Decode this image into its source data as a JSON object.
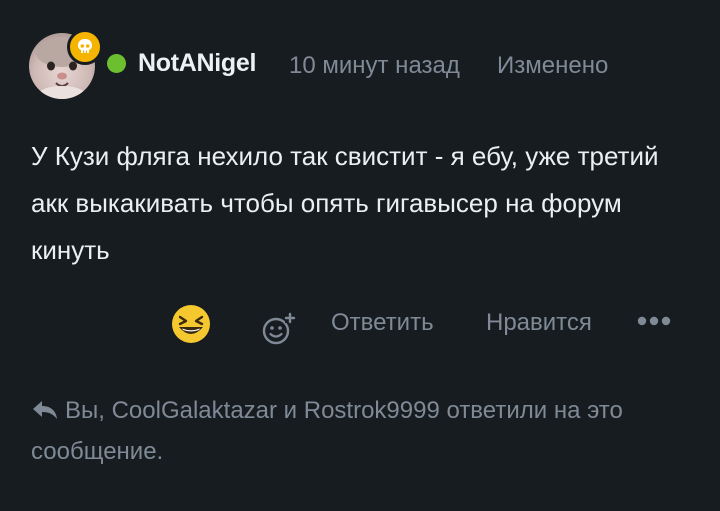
{
  "post": {
    "author": {
      "name": "NotANigel",
      "online": true,
      "badge_icon": "skull-icon"
    },
    "meta": {
      "time": "10 минут назад",
      "edited": "Изменено"
    },
    "message": "У Кузи фляга нехило так свистит - я ебу, уже третий акк выкакивать чтобы опять гигавысер на форум кинуть",
    "actions": {
      "reaction_icon": "laughing-emoji-icon",
      "add_reaction_icon": "add-reaction-icon",
      "reply_label": "Ответить",
      "like_label": "Нравится",
      "more_icon": "more-dots-icon"
    },
    "replies": {
      "text": "Вы, CoolGalaktazar и Rostrok9999 ответили на это сообщение."
    }
  },
  "colors": {
    "background": "#171c21",
    "muted_text": "#7f8a96",
    "online": "#6cbf2f",
    "badge": "#f4b400",
    "emoji": "#f6c830"
  }
}
